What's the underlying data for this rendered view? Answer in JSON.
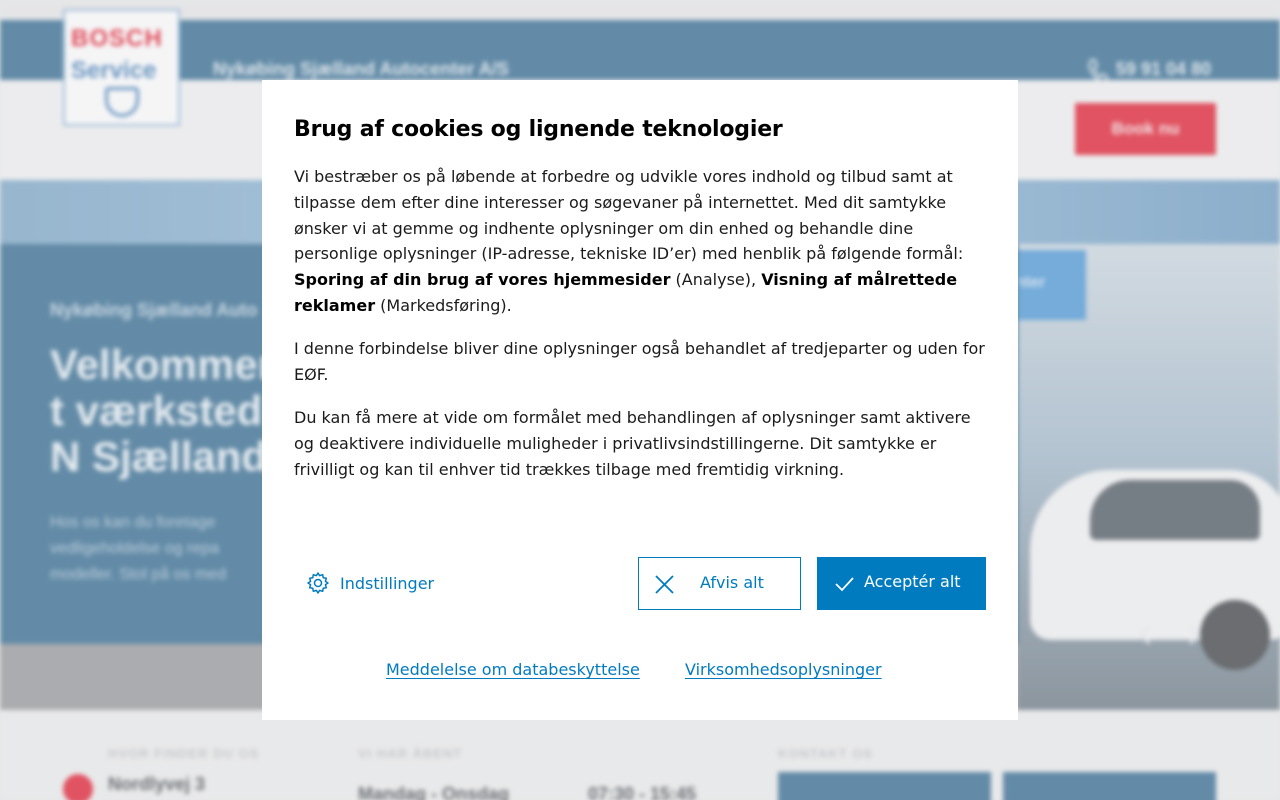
{
  "background": {
    "dealer_name": "Nykøbing Sjælland Autocenter A/S",
    "phone": "59 91 04 80",
    "logo": {
      "line1": "BOSCH",
      "line2": "Service"
    },
    "book_button": "Book nu",
    "hero": {
      "subtitle": "Nykøbing Sjælland Auto",
      "title": "Velkommen t værksted i N Sjælland",
      "text": "Hos os kan du foretage vedligeholdelse og repa modeller. Stol på os med",
      "sign_text": "nter"
    },
    "footer": {
      "label_find": "HVOR FINDER DU OS",
      "address": "Nordlyvej 3",
      "label_open": "VI HAR ÅBENT",
      "days": "Mandag - Onsdag",
      "hours": "07:30 - 15:45",
      "label_contact": "KONTAKT OS"
    }
  },
  "dialog": {
    "title": "Brug af cookies og lignende teknologier",
    "p1": {
      "text": "Vi bestræber os på løbende at forbedre og udvikle vores indhold og tilbud samt at tilpasse dem efter dine interesser og søgevaner på internettet. Med dit samtykke ønsker vi at gemme og indhente oplysninger om din enhed og behandle dine personlige oplysninger (IP-adresse, tekniske ID’er) med henblik på følgende formål: ",
      "bold1": "Sporing af din brug af vores hjemmesider",
      "mid": " (Analyse), ",
      "bold2": "Visning af målrettede reklamer",
      "end": " (Markedsføring)."
    },
    "p2": "I denne forbindelse bliver dine oplysninger også behandlet af tredjeparter og uden for EØF.",
    "p3": "Du kan få mere at vide om formålet med behandlingen af oplysninger samt aktivere og deaktivere individuelle muligheder i privatlivsindstillingerne. Dit samtykke er frivilligt og kan til enhver tid trækkes tilbage med fremtidig virkning.",
    "settings_label": "Indstillinger",
    "reject_label": "Afvis alt",
    "accept_label": "Acceptér alt",
    "link_privacy": "Meddelelse om databeskyttelse",
    "link_company": "Virksomhedsoplysninger",
    "colors": {
      "primary": "#007bc0",
      "brand_red": "#e0071c",
      "header_blue": "#1f5d86"
    }
  }
}
